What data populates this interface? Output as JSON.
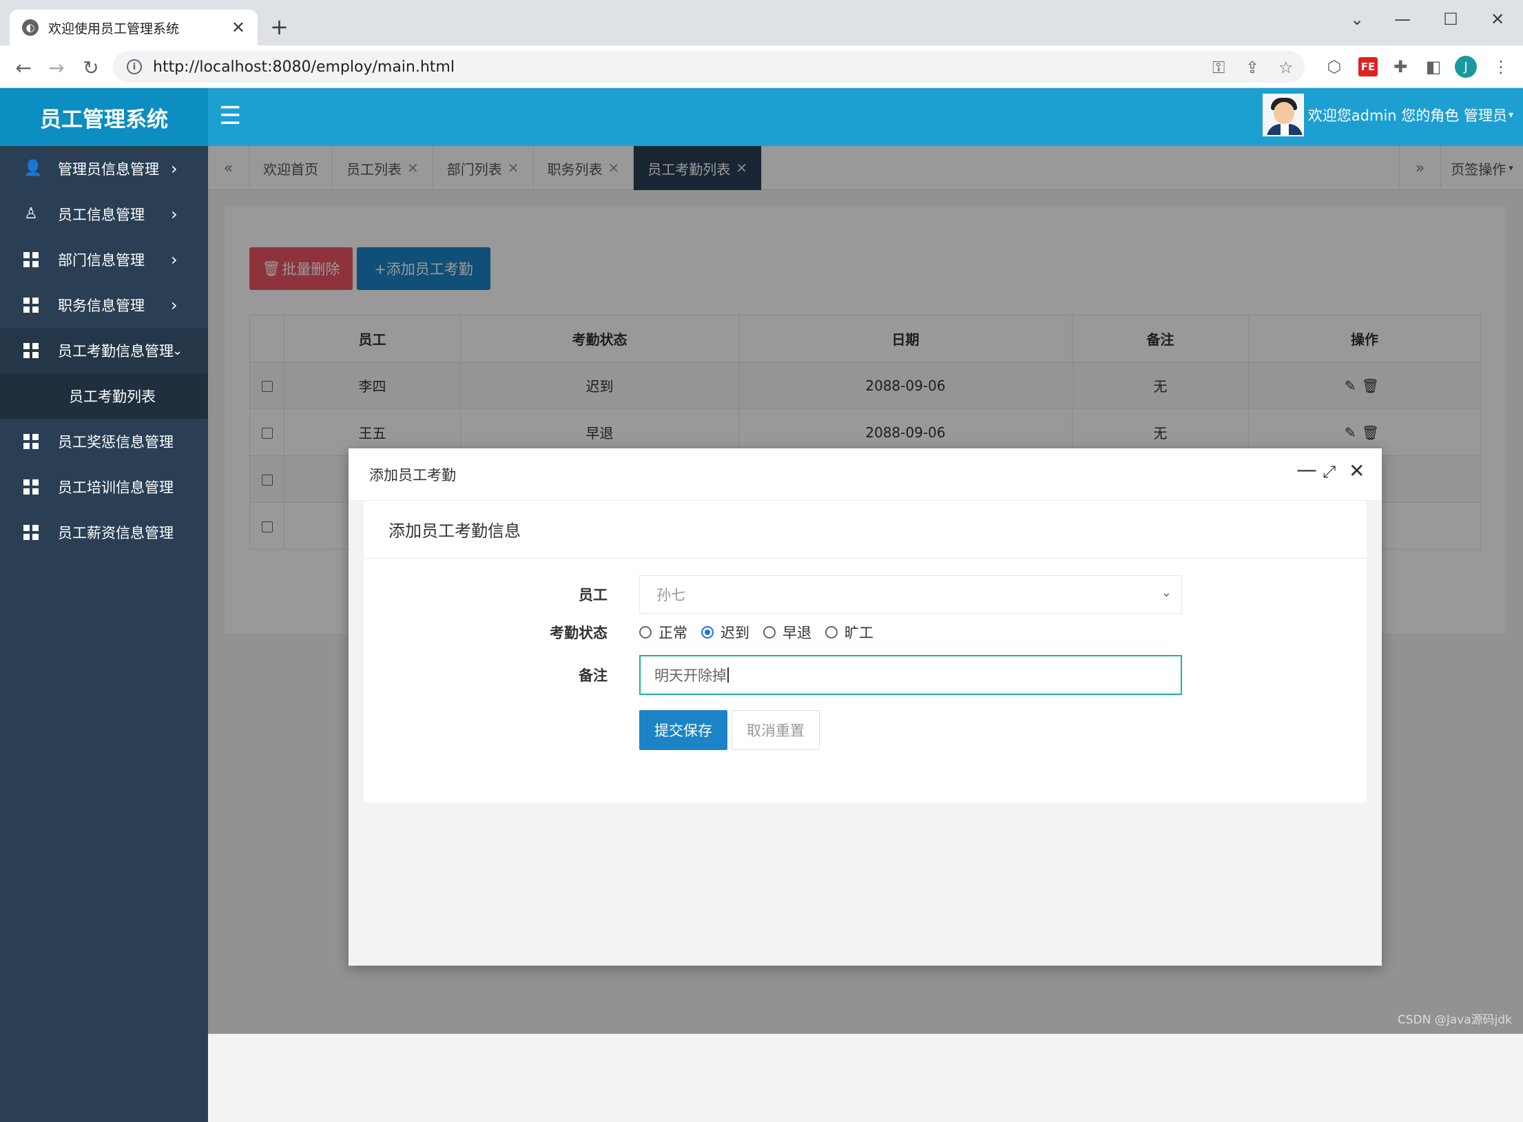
{
  "browser": {
    "tab_title": "欢迎使用员工管理系统",
    "url": "http://localhost:8080/employ/main.html",
    "avatar_letter": "J",
    "fe_label": "FE"
  },
  "header": {
    "brand": "员工管理系统",
    "user_text": "欢迎您admin 您的角色 管理员",
    "accent_color": "#1e9fd2"
  },
  "sidebar": {
    "items": [
      {
        "label": "管理员信息管理",
        "icon": "user-group-icon"
      },
      {
        "label": "员工信息管理",
        "icon": "user-icon"
      },
      {
        "label": "部门信息管理",
        "icon": "grid-icon"
      },
      {
        "label": "职务信息管理",
        "icon": "grid-icon"
      },
      {
        "label": "员工考勤信息管理",
        "icon": "grid-icon"
      },
      {
        "label": "员工奖惩信息管理",
        "icon": "grid-icon"
      },
      {
        "label": "员工培训信息管理",
        "icon": "grid-icon"
      },
      {
        "label": "员工薪资信息管理",
        "icon": "grid-icon"
      }
    ],
    "sub_item": "员工考勤列表"
  },
  "page_tabs": {
    "tabs": [
      "欢迎首页",
      "员工列表",
      "部门列表",
      "职务列表",
      "员工考勤列表"
    ],
    "active": "员工考勤列表",
    "ops_label": "页签操作"
  },
  "toolbar": {
    "delete_label": "批量删除",
    "add_label": "+添加员工考勤"
  },
  "table": {
    "headers": [
      "员工",
      "考勤状态",
      "日期",
      "备注",
      "操作"
    ],
    "rows": [
      {
        "employee": "李四",
        "status": "迟到",
        "date": "2088-09-06",
        "note": "无"
      },
      {
        "employee": "王五",
        "status": "早退",
        "date": "2088-09-06",
        "note": "无"
      }
    ]
  },
  "modal": {
    "window_title": "添加员工考勤",
    "form_title": "添加员工考勤信息",
    "employee_label": "员工",
    "employee_value": "孙七",
    "status_label": "考勤状态",
    "status_options": [
      "正常",
      "迟到",
      "早退",
      "旷工"
    ],
    "status_selected": "迟到",
    "note_label": "备注",
    "note_value": "明天开除掉",
    "save_label": "提交保存",
    "cancel_label": "取消重置"
  },
  "watermark": "CSDN @Java源码jdk"
}
